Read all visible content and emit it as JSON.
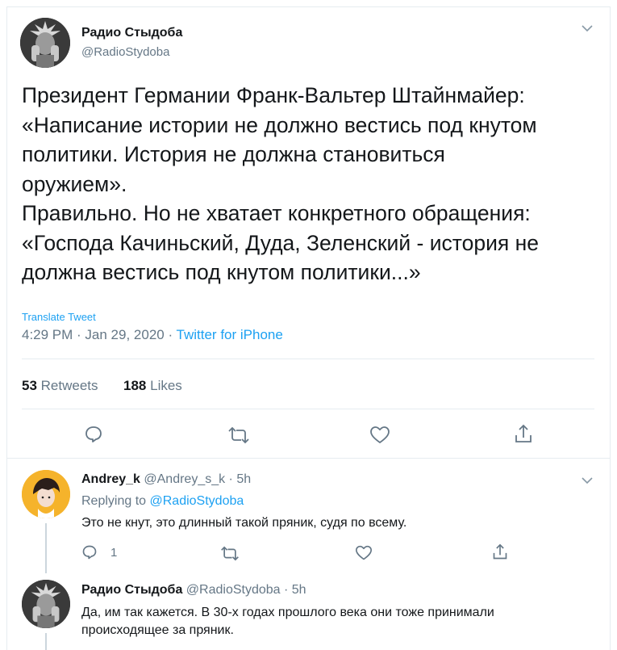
{
  "tweet": {
    "author_name": "Радио Стыдоба",
    "author_handle": "@RadioStydoba",
    "text_lines": [
      "Президент Германии Франк-Вальтер Штайнмайер:",
      "«Написание истории не должно вестись под кнутом",
      "политики. История не должна становиться",
      "оружием».",
      "Правильно. Но не хватает конкретного обращения:",
      "«Господа Качиньский, Дуда, Зеленский - история не",
      "должна вестись под кнутом политики...»"
    ],
    "translate_label": "Translate Tweet",
    "time": "4:29 PM · Jan 29, 2020 · ",
    "source": "Twitter for iPhone",
    "retweets_count": "53",
    "retweets_label": "Retweets",
    "likes_count": "188",
    "likes_label": "Likes"
  },
  "replies": [
    {
      "author_name": "Andrey_k",
      "author_meta": "@Andrey_s_k · 5h",
      "replying_prefix": "Replying to ",
      "replying_handle": "@RadioStydoba",
      "text_lines": [
        "Это не кнут, это длинный такой пряник, судя по всему."
      ],
      "reply_count": "1",
      "avatar_color": "#f5b32b"
    },
    {
      "author_name": "Радио Стыдоба",
      "author_meta": "@RadioStydoba · 5h",
      "text_lines": [
        "Да, им так кажется. В 30-х годах прошлого века они тоже принимали",
        "происходящее за пряник."
      ]
    }
  ],
  "colors": {
    "accent": "#1da1f2",
    "secondary_text": "#657786",
    "border": "#e6ecf0"
  },
  "icons": [
    "reply-icon",
    "retweet-icon",
    "like-icon",
    "share-icon",
    "chevron-down-icon"
  ]
}
